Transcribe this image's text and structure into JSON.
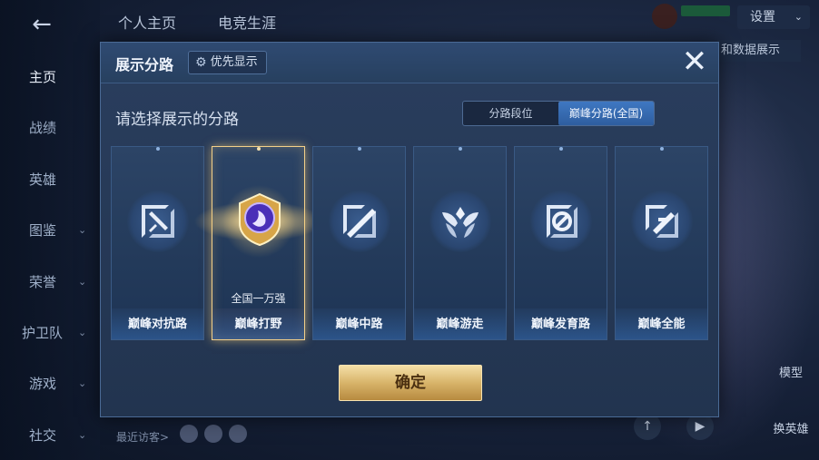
{
  "sidebar": {
    "back_icon": "back-arrow-icon",
    "items": [
      {
        "label": "主页",
        "active": true,
        "has_chevron": false
      },
      {
        "label": "战绩",
        "active": false,
        "has_chevron": false
      },
      {
        "label": "英雄",
        "active": false,
        "has_chevron": false
      },
      {
        "label": "图鉴",
        "active": false,
        "has_chevron": true
      },
      {
        "label": "荣誉",
        "active": false,
        "has_chevron": true
      },
      {
        "label": "护卫队",
        "active": false,
        "has_chevron": true
      },
      {
        "label": "游戏",
        "active": false,
        "has_chevron": true
      },
      {
        "label": "社交",
        "active": false,
        "has_chevron": true
      }
    ]
  },
  "topbar": {
    "tabs": [
      "个人主页",
      "电竞生涯"
    ],
    "settings_label": "设置",
    "data_display_label": "和数据展示"
  },
  "background": {
    "model_label": "模型",
    "swap_hero_label": "换英雄",
    "recent_visitors_label": "最近访客>"
  },
  "modal": {
    "title": "展示分路",
    "priority_label": "优先显示",
    "section_title": "请选择展示的分路",
    "segments": [
      {
        "label": "分路段位",
        "active": false
      },
      {
        "label": "巅峰分路(全国)",
        "active": true
      }
    ],
    "cards": [
      {
        "name": "巅峰对抗路",
        "icon": "sword-lane-icon",
        "selected": false,
        "rank": ""
      },
      {
        "name": "巅峰打野",
        "icon": "jungle-medal-icon",
        "selected": true,
        "rank": "全国一万强"
      },
      {
        "name": "巅峰中路",
        "icon": "mid-lane-icon",
        "selected": false,
        "rank": ""
      },
      {
        "name": "巅峰游走",
        "icon": "roam-wings-icon",
        "selected": false,
        "rank": ""
      },
      {
        "name": "巅峰发育路",
        "icon": "farm-lane-icon",
        "selected": false,
        "rank": ""
      },
      {
        "name": "巅峰全能",
        "icon": "all-round-icon",
        "selected": false,
        "rank": ""
      }
    ],
    "confirm_label": "确定",
    "accent_gold": "#f4d089",
    "accent_blue": "#3f78c2"
  }
}
